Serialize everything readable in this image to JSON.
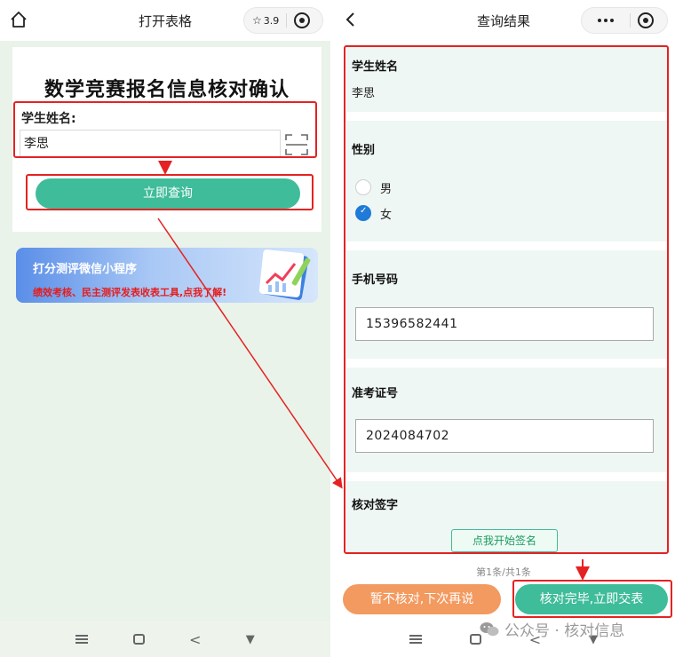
{
  "left": {
    "header": {
      "title": "打开表格",
      "rating": "3.9"
    },
    "form": {
      "title": "数学竞赛报名信息核对确认",
      "name_label": "学生姓名:",
      "name_value": "李思",
      "query_button": "立即查询"
    },
    "banner": {
      "title": "打分测评微信小程序",
      "subtitle": "绩效考核、民主测评发表收表工具,点我了解!"
    }
  },
  "right": {
    "header": {
      "title": "查询结果"
    },
    "fields": {
      "name": {
        "label": "学生姓名",
        "value": "李思"
      },
      "gender": {
        "label": "性别",
        "options": [
          "男",
          "女"
        ],
        "selected": "女"
      },
      "phone": {
        "label": "手机号码",
        "value": "15396582441"
      },
      "ticket": {
        "label": "准考证号",
        "value": "2024084702"
      },
      "signature": {
        "label": "核对签字",
        "button": "点我开始签名"
      }
    },
    "pager": "第1条/共1条",
    "later_button": "暂不核对,下次再说",
    "confirm_button": "核对完毕,立即交表"
  },
  "watermark": "公众号 · 核对信息",
  "colors": {
    "primary_green": "#3fbc9a",
    "orange": "#f39a60",
    "annotation_red": "#e52222",
    "radio_blue": "#1f7ad8"
  },
  "icons": [
    "home-icon",
    "star-icon",
    "target-icon",
    "scan-icon",
    "back-icon",
    "more-icon",
    "wechat-icon"
  ]
}
